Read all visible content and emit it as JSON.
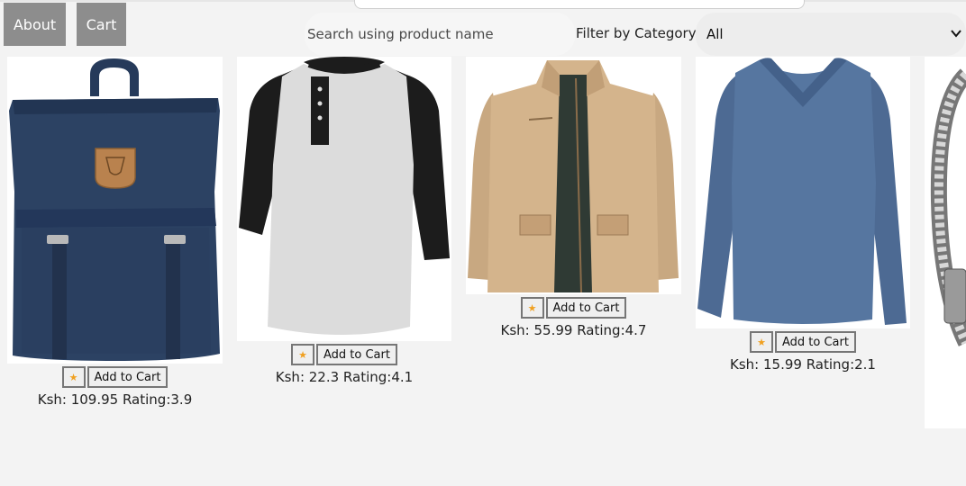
{
  "nav": {
    "about_label": "About",
    "cart_label": "Cart"
  },
  "search": {
    "placeholder": "Search using product name",
    "value": ""
  },
  "filter": {
    "label": "Filter by Category:",
    "selected": "All"
  },
  "products": [
    {
      "image": "backpack",
      "star": "★",
      "add_label": "Add to Cart",
      "price_text": "Ksh: 109.95 Rating:3.9"
    },
    {
      "image": "raglan-henley-tshirt",
      "star": "★",
      "add_label": "Add to Cart",
      "price_text": "Ksh: 22.3 Rating:4.1"
    },
    {
      "image": "khaki-jacket",
      "star": "★",
      "add_label": "Add to Cart",
      "price_text": "Ksh: 55.99 Rating:4.7"
    },
    {
      "image": "blue-long-sleeve-tshirt",
      "star": "★",
      "add_label": "Add to Cart",
      "price_text": "Ksh: 15.99 Rating:2.1"
    },
    {
      "image": "silver-chain-bracelet"
    }
  ],
  "colors": {
    "nav_button": "#8d8d8d",
    "star": "#f0a020",
    "background": "#f3f3f3"
  }
}
